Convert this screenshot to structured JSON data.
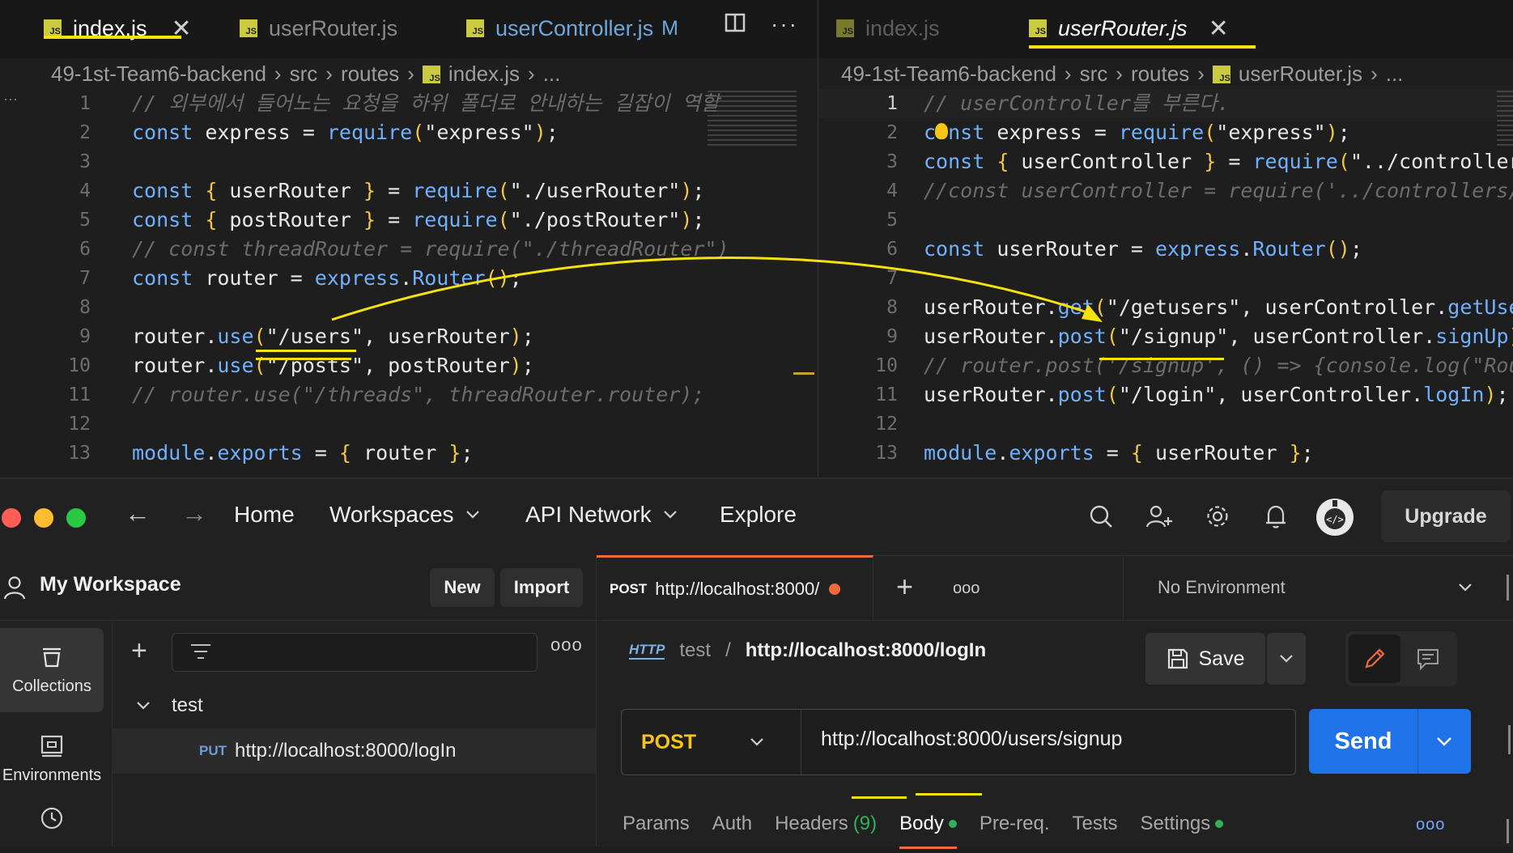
{
  "editor": {
    "left_pane": {
      "tabs": [
        {
          "name": "index.js",
          "active": true,
          "closable": true
        },
        {
          "name": "userRouter.js",
          "active": false
        },
        {
          "name": "userController.js",
          "status": "M"
        }
      ],
      "breadcrumb": [
        "49-1st-Team6-backend",
        "src",
        "routes",
        "index.js",
        "..."
      ],
      "lines": [
        {
          "n": "1",
          "tokens": [
            [
              "cm",
              "// 외부에서 들어노는 요청을 하위 폴더로 안내하는 길잡이 역할"
            ]
          ]
        },
        {
          "n": "2",
          "tokens": [
            [
              "kw",
              "const "
            ],
            [
              "id",
              "express "
            ],
            [
              "op",
              "= "
            ],
            [
              "fn",
              "require"
            ],
            [
              "br",
              "("
            ],
            [
              "str",
              "\"express\""
            ],
            [
              "br",
              ")"
            ],
            [
              "op",
              ";"
            ]
          ]
        },
        {
          "n": "3",
          "tokens": []
        },
        {
          "n": "4",
          "tokens": [
            [
              "kw",
              "const "
            ],
            [
              "br",
              "{ "
            ],
            [
              "id",
              "userRouter "
            ],
            [
              "br",
              "} "
            ],
            [
              "op",
              "= "
            ],
            [
              "fn",
              "require"
            ],
            [
              "br",
              "("
            ],
            [
              "str",
              "\"./userRouter\""
            ],
            [
              "br",
              ")"
            ],
            [
              "op",
              ";"
            ]
          ]
        },
        {
          "n": "5",
          "tokens": [
            [
              "kw",
              "const "
            ],
            [
              "br",
              "{ "
            ],
            [
              "id",
              "postRouter "
            ],
            [
              "br",
              "} "
            ],
            [
              "op",
              "= "
            ],
            [
              "fn",
              "require"
            ],
            [
              "br",
              "("
            ],
            [
              "str",
              "\"./postRouter\""
            ],
            [
              "br",
              ")"
            ],
            [
              "op",
              ";"
            ]
          ]
        },
        {
          "n": "6",
          "tokens": [
            [
              "cm",
              "// const threadRouter = require(\"./threadRouter\")"
            ]
          ]
        },
        {
          "n": "7",
          "tokens": [
            [
              "kw",
              "const "
            ],
            [
              "id",
              "router "
            ],
            [
              "op",
              "= "
            ],
            [
              "fn",
              "express"
            ],
            [
              "op",
              "."
            ],
            [
              "fn",
              "Router"
            ],
            [
              "br",
              "()"
            ],
            [
              "op",
              ";"
            ]
          ]
        },
        {
          "n": "8",
          "tokens": []
        },
        {
          "n": "9",
          "tokens": [
            [
              "id",
              "router"
            ],
            [
              "op",
              "."
            ],
            [
              "fn",
              "use"
            ],
            [
              "br",
              "("
            ],
            [
              "str",
              "\"/users\""
            ],
            [
              "op",
              ", "
            ],
            [
              "id",
              "userRouter"
            ],
            [
              "br",
              ")"
            ],
            [
              "op",
              ";"
            ]
          ]
        },
        {
          "n": "10",
          "tokens": [
            [
              "id",
              "router"
            ],
            [
              "op",
              "."
            ],
            [
              "fn",
              "use"
            ],
            [
              "br",
              "("
            ],
            [
              "str",
              "\"/posts\""
            ],
            [
              "op",
              ", "
            ],
            [
              "id",
              "postRouter"
            ],
            [
              "br",
              ")"
            ],
            [
              "op",
              ";"
            ]
          ]
        },
        {
          "n": "11",
          "tokens": [
            [
              "cm",
              "// router.use(\"/threads\", threadRouter.router);"
            ]
          ]
        },
        {
          "n": "12",
          "tokens": []
        },
        {
          "n": "13",
          "tokens": [
            [
              "fn",
              "module"
            ],
            [
              "op",
              "."
            ],
            [
              "fn",
              "exports "
            ],
            [
              "op",
              "= "
            ],
            [
              "br",
              "{ "
            ],
            [
              "id",
              "router "
            ],
            [
              "br",
              "}"
            ],
            [
              "op",
              ";"
            ]
          ]
        }
      ]
    },
    "right_pane": {
      "tabs": [
        {
          "name": "index.js",
          "active": false
        },
        {
          "name": "userRouter.js",
          "active": true,
          "closable": true
        }
      ],
      "breadcrumb": [
        "49-1st-Team6-backend",
        "src",
        "routes",
        "userRouter.js",
        "..."
      ],
      "lines": [
        {
          "n": "1",
          "tokens": [
            [
              "cm",
              "// userController를 부른다."
            ]
          ]
        },
        {
          "n": "2",
          "tokens": [
            [
              "kw",
              "const "
            ],
            [
              "id",
              "express "
            ],
            [
              "op",
              "= "
            ],
            [
              "fn",
              "require"
            ],
            [
              "br",
              "("
            ],
            [
              "str",
              "\"express\""
            ],
            [
              "br",
              ")"
            ],
            [
              "op",
              ";"
            ]
          ]
        },
        {
          "n": "3",
          "tokens": [
            [
              "kw",
              "const "
            ],
            [
              "br",
              "{ "
            ],
            [
              "id",
              "userController "
            ],
            [
              "br",
              "} "
            ],
            [
              "op",
              "= "
            ],
            [
              "fn",
              "require"
            ],
            [
              "br",
              "("
            ],
            [
              "str",
              "\"../controller"
            ]
          ]
        },
        {
          "n": "4",
          "tokens": [
            [
              "cm",
              "//const userController = require('../controllers/"
            ]
          ]
        },
        {
          "n": "5",
          "tokens": []
        },
        {
          "n": "6",
          "tokens": [
            [
              "kw",
              "const "
            ],
            [
              "id",
              "userRouter "
            ],
            [
              "op",
              "= "
            ],
            [
              "fn",
              "express"
            ],
            [
              "op",
              "."
            ],
            [
              "fn",
              "Router"
            ],
            [
              "br",
              "()"
            ],
            [
              "op",
              ";"
            ]
          ]
        },
        {
          "n": "7",
          "tokens": []
        },
        {
          "n": "8",
          "tokens": [
            [
              "id",
              "userRouter"
            ],
            [
              "op",
              "."
            ],
            [
              "fn",
              "get"
            ],
            [
              "br",
              "("
            ],
            [
              "str",
              "\"/getusers\""
            ],
            [
              "op",
              ", "
            ],
            [
              "id",
              "userController"
            ],
            [
              "op",
              "."
            ],
            [
              "fn",
              "getUse"
            ]
          ]
        },
        {
          "n": "9",
          "tokens": [
            [
              "id",
              "userRouter"
            ],
            [
              "op",
              "."
            ],
            [
              "fn",
              "post"
            ],
            [
              "br",
              "("
            ],
            [
              "str",
              "\"/signup\""
            ],
            [
              "op",
              ", "
            ],
            [
              "id",
              "userController"
            ],
            [
              "op",
              "."
            ],
            [
              "fn",
              "signUp"
            ],
            [
              "br",
              ")"
            ]
          ]
        },
        {
          "n": "10",
          "tokens": [
            [
              "cm",
              "// router.post('/signup', () => {console.log(\"Rou"
            ]
          ]
        },
        {
          "n": "11",
          "tokens": [
            [
              "id",
              "userRouter"
            ],
            [
              "op",
              "."
            ],
            [
              "fn",
              "post"
            ],
            [
              "br",
              "("
            ],
            [
              "str",
              "\"/login\""
            ],
            [
              "op",
              ", "
            ],
            [
              "id",
              "userController"
            ],
            [
              "op",
              "."
            ],
            [
              "fn",
              "logIn"
            ],
            [
              "br",
              ")"
            ],
            [
              "op",
              ";"
            ]
          ]
        },
        {
          "n": "12",
          "tokens": []
        },
        {
          "n": "13",
          "tokens": [
            [
              "fn",
              "module"
            ],
            [
              "op",
              "."
            ],
            [
              "fn",
              "exports "
            ],
            [
              "op",
              "= "
            ],
            [
              "br",
              "{ "
            ],
            [
              "id",
              "userRouter "
            ],
            [
              "br",
              "}"
            ],
            [
              "op",
              ";"
            ]
          ]
        }
      ]
    }
  },
  "postman": {
    "nav": {
      "home": "Home",
      "workspaces": "Workspaces",
      "api_network": "API Network",
      "explore": "Explore",
      "upgrade": "Upgrade"
    },
    "workspace": {
      "title": "My Workspace",
      "new_label": "New",
      "import_label": "Import"
    },
    "rail": {
      "collections": "Collections",
      "environments": "Environments"
    },
    "tree": {
      "collection": "test",
      "request_method": "PUT",
      "request_url": "http://localhost:8000/logIn"
    },
    "request_tab": {
      "method": "POST",
      "url": "http://localhost:8000/"
    },
    "environment": "No Environment",
    "request": {
      "breadcrumb_collection": "test",
      "breadcrumb_sep": "/",
      "breadcrumb_name": "http://localhost:8000/logIn",
      "save_label": "Save",
      "method": "POST",
      "url": "http://localhost:8000/users/signup",
      "send_label": "Send"
    },
    "subtabs": {
      "params": "Params",
      "auth": "Auth",
      "headers": "Headers",
      "headers_count": "(9)",
      "body": "Body",
      "prereq": "Pre-req.",
      "tests": "Tests",
      "settings": "Settings"
    }
  },
  "colors": {
    "annotation": "#f5e10f",
    "postman_orange": "#f26b3a",
    "send_blue": "#1f72e8",
    "method_post": "#f5c518"
  }
}
